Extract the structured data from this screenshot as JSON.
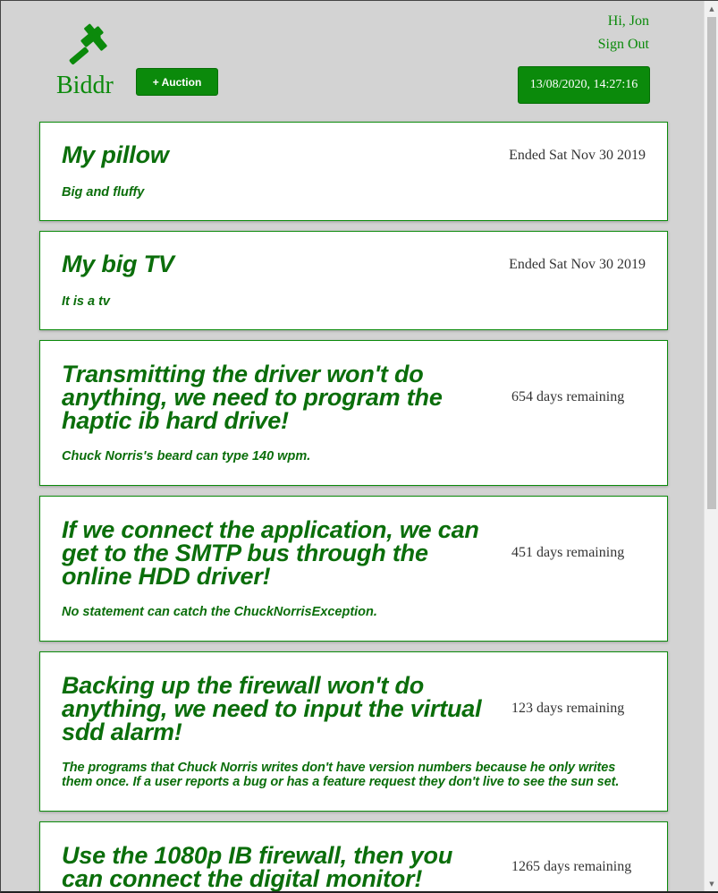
{
  "header": {
    "brand": "Biddr",
    "logo_icon": "gavel-icon",
    "add_auction_label": "+ Auction",
    "greeting": "Hi, Jon",
    "sign_out_label": "Sign Out",
    "clock": "13/08/2020, 14:27:16"
  },
  "colors": {
    "accent": "#0b8a0b",
    "background": "#d3d3d3",
    "card_bg": "#ffffff"
  },
  "auctions": [
    {
      "title": "My pillow",
      "description": "Big and fluffy",
      "status": "Ended Sat Nov 30 2019"
    },
    {
      "title": "My big TV",
      "description": "It is a tv",
      "status": "Ended Sat Nov 30 2019"
    },
    {
      "title": "Transmitting the driver won't do anything, we need to program the haptic ib hard drive!",
      "description": "Chuck Norris's beard can type 140 wpm.",
      "status": "654 days remaining"
    },
    {
      "title": "If we connect the application, we can get to the SMTP bus through the online HDD driver!",
      "description": "No statement can catch the ChuckNorrisException.",
      "status": "451 days remaining"
    },
    {
      "title": "Backing up the firewall won't do anything, we need to input the virtual sdd alarm!",
      "description": "The programs that Chuck Norris writes don't have version numbers because he only writes them once. If a user reports a bug or has a feature request they don't live to see the sun set.",
      "status": "123 days remaining"
    },
    {
      "title": "Use the 1080p IB firewall, then you can connect the digital monitor!",
      "description": "",
      "status": "1265 days remaining"
    }
  ]
}
